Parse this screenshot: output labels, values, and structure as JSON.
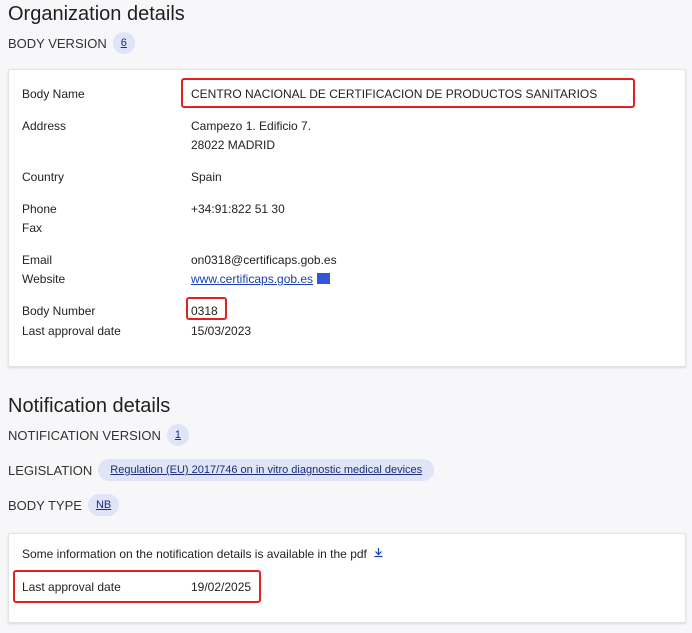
{
  "org": {
    "title": "Organization details",
    "body_version_label": "BODY VERSION",
    "body_version": "6",
    "body_name_label": "Body Name",
    "body_name": "CENTRO NACIONAL DE CERTIFICACION DE PRODUCTOS SANITARIOS",
    "address_label": "Address",
    "address_line1": "Campezo 1. Edificio 7.",
    "address_line2": "28022 MADRID",
    "country_label": "Country",
    "country": "Spain",
    "phone_label": "Phone",
    "phone": "+34:91:822 51 30",
    "fax_label": "Fax",
    "email_label": "Email",
    "email": "on0318@certificaps.gob.es",
    "website_label": "Website",
    "website": "www.certificaps.gob.es",
    "body_number_label": "Body Number",
    "body_number": "0318",
    "last_approval_label": "Last approval date",
    "last_approval": "15/03/2023"
  },
  "notif": {
    "title": "Notification details",
    "version_label": "NOTIFICATION VERSION",
    "version": "1",
    "legislation_label": "LEGISLATION",
    "legislation": "Regulation (EU) 2017/746 on in vitro diagnostic medical devices",
    "body_type_label": "BODY TYPE",
    "body_type": "NB",
    "info_text": "Some information on the notification details is available in the pdf",
    "last_approval_label": "Last approval date",
    "last_approval": "19/02/2025"
  },
  "colors": {
    "highlight": "#e0231e",
    "chip_bg": "#dfe4f6",
    "link": "#1a3fb0"
  }
}
